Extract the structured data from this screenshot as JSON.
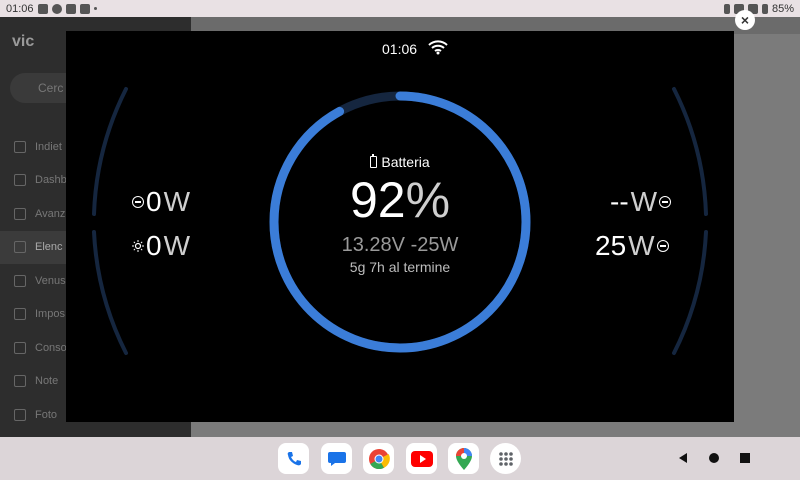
{
  "status_bar": {
    "time": "01:06",
    "battery": "85%"
  },
  "background_app": {
    "logo": "vic",
    "search_placeholder": "Cerc",
    "menu": [
      "Indiet",
      "Dashb",
      "Avanz",
      "Elenc",
      "Venus",
      "Impos",
      "Conso",
      "Note",
      "Foto"
    ],
    "active_index": 3
  },
  "overlay": {
    "time": "01:06",
    "battery": {
      "label": "Batteria",
      "percent": "92",
      "percent_unit": "%",
      "voltage": "13.28",
      "voltage_unit": "V",
      "power": "-25",
      "power_unit": "W",
      "remaining": "5g 7h al termine",
      "level": 0.92
    },
    "left": [
      {
        "value": "0",
        "unit": "W",
        "icon": "ac-input-icon"
      },
      {
        "value": "0",
        "unit": "W",
        "icon": "solar-icon"
      }
    ],
    "right": [
      {
        "value": "--",
        "unit": "W",
        "icon": "ac-output-icon"
      },
      {
        "value": "25",
        "unit": "W",
        "icon": "dc-load-icon"
      }
    ]
  },
  "colors": {
    "accent": "#3b7dd8",
    "track": "#15263f",
    "background": "#000000"
  },
  "taskbar": {
    "apps": [
      "phone-app",
      "messages-app",
      "chrome-app",
      "youtube-app",
      "maps-app",
      "app-drawer"
    ]
  }
}
